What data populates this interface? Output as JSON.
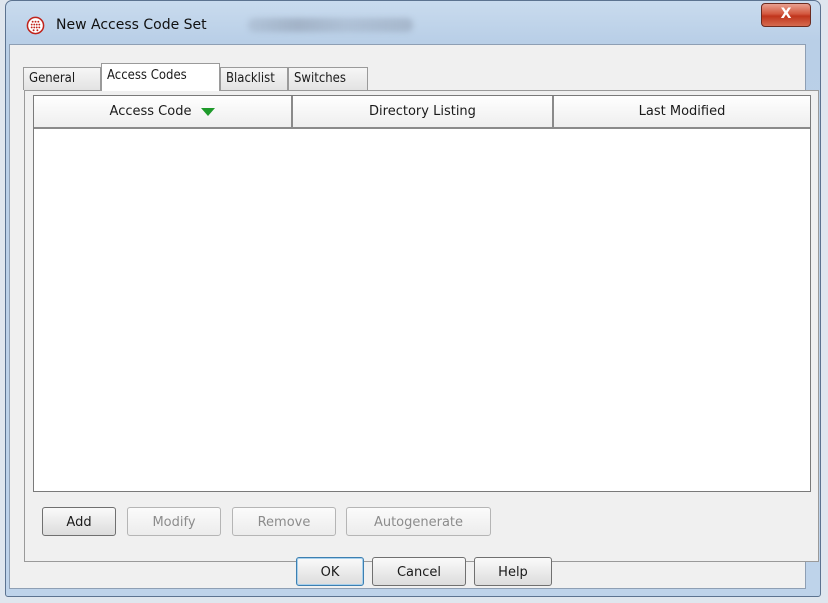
{
  "window": {
    "title": "New Access Code Set",
    "close_label": "X"
  },
  "tabs": [
    {
      "label": "General",
      "active": false
    },
    {
      "label": "Access Codes",
      "active": true
    },
    {
      "label": "Blacklist",
      "active": false
    },
    {
      "label": "Switches",
      "active": false
    }
  ],
  "table": {
    "columns": [
      {
        "label": "Access Code",
        "sorted": "descending"
      },
      {
        "label": "Directory Listing"
      },
      {
        "label": "Last Modified"
      }
    ],
    "rows": []
  },
  "actions": {
    "add": "Add",
    "modify": "Modify",
    "remove": "Remove",
    "autogenerate": "Autogenerate"
  },
  "dialog_buttons": {
    "ok": "OK",
    "cancel": "Cancel",
    "help": "Help"
  },
  "colors": {
    "sort_indicator": "#1e9a2a",
    "close_button": "#c0351c"
  }
}
